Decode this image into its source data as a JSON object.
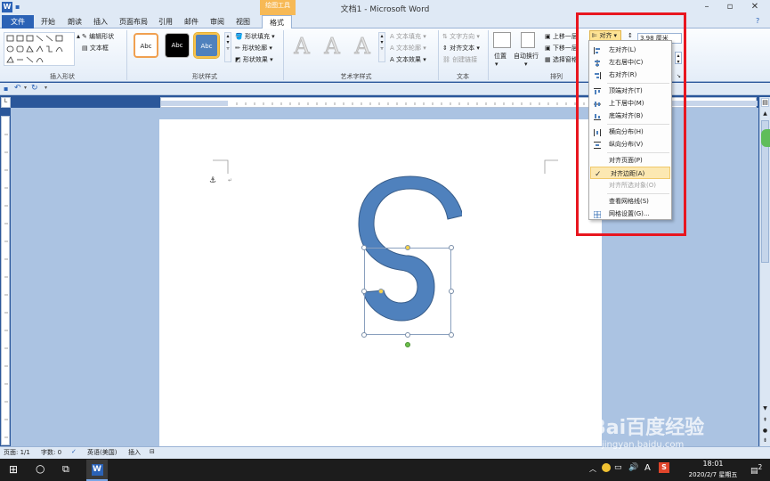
{
  "titlebar": {
    "title": "文档1 - Microsoft Word",
    "context_tab": "绘图工具"
  },
  "tabs": [
    "文件",
    "开始",
    "朗读",
    "插入",
    "页面布局",
    "引用",
    "邮件",
    "审阅",
    "视图",
    "格式"
  ],
  "ribbon": {
    "insert_shapes": {
      "edit_shape": "编辑形状",
      "text_box": "文本框",
      "label": "插入形状"
    },
    "shape_styles": {
      "abc": "Abc",
      "fill": "形状填充",
      "outline": "形状轮廓",
      "effects": "形状效果",
      "label": "形状样式"
    },
    "wordart": {
      "a": "A",
      "fill": "文本填充",
      "outline": "文本轮廓",
      "effects": "文本效果",
      "label": "艺术字样式"
    },
    "text": {
      "direction": "文字方向",
      "align_text": "对齐文本",
      "create_link": "创建链接",
      "label": "文本"
    },
    "arrange": {
      "position": "位置",
      "wrap": "自动换行",
      "bring_forward": "上移一层",
      "send_backward": "下移一层",
      "selection_pane": "选择窗格",
      "align": "对齐",
      "label": "排列"
    },
    "size": {
      "height": "3.98 厘米"
    }
  },
  "align_menu": {
    "items": [
      {
        "label": "左对齐(L)",
        "disabled": false
      },
      {
        "label": "左右居中(C)",
        "disabled": false
      },
      {
        "label": "右对齐(R)",
        "disabled": false
      },
      {
        "label": "顶端对齐(T)",
        "disabled": false
      },
      {
        "label": "上下居中(M)",
        "disabled": false
      },
      {
        "label": "底端对齐(B)",
        "disabled": false
      },
      {
        "label": "横向分布(H)",
        "disabled": false
      },
      {
        "label": "纵向分布(V)",
        "disabled": false
      },
      {
        "label": "对齐页面(P)",
        "disabled": false
      },
      {
        "label": "对齐边距(A)",
        "disabled": false,
        "checked": true
      },
      {
        "label": "对齐所选对象(O)",
        "disabled": true
      },
      {
        "label": "查看网格线(S)",
        "disabled": false
      },
      {
        "label": "网格设置(G)...",
        "disabled": false
      }
    ]
  },
  "statusbar": {
    "page": "页面: 1/1",
    "words": "字数: 0",
    "language": "英语(美国)",
    "mode": "插入"
  },
  "taskbar": {
    "ime": "A",
    "time": "18:01",
    "date": "2020/2/7 星期五",
    "notif": "2"
  },
  "watermark": {
    "brand": "Bai百度经验",
    "url": "jingyan.baidu.com"
  },
  "colors": {
    "shape": "#4f81bd",
    "accent": "#2b579a",
    "highlight": "#e8161f"
  }
}
